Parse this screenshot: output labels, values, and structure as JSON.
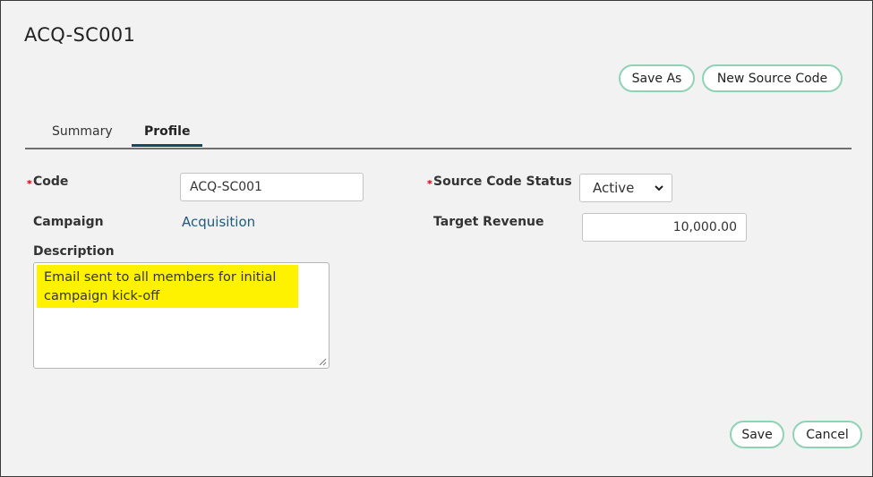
{
  "page": {
    "title": "ACQ-SC001"
  },
  "toolbar": {
    "save_as_label": "Save As",
    "new_source_code_label": "New Source Code"
  },
  "tabs": [
    {
      "label": "Summary",
      "active": false
    },
    {
      "label": "Profile",
      "active": true
    }
  ],
  "form": {
    "code": {
      "label": "Code",
      "required": true,
      "value": "ACQ-SC001"
    },
    "campaign": {
      "label": "Campaign",
      "value": "Acquisition"
    },
    "description": {
      "label": "Description",
      "value": "Email sent to all members for initial campaign kick-off"
    },
    "source_code_status": {
      "label": "Source Code Status",
      "required": true,
      "selected": "Active"
    },
    "target_revenue": {
      "label": "Target Revenue",
      "value": "10,000.00"
    }
  },
  "footer": {
    "save_label": "Save",
    "cancel_label": "Cancel"
  },
  "colors": {
    "button_border": "#8fd3b4",
    "tab_active_underline": "#0f4c5c",
    "link": "#1e5b7e",
    "required": "#cc0000",
    "highlight": "#fff200"
  },
  "icons": {
    "select_caret": "chevron-down-icon",
    "textarea_grip": "resize-grip-icon"
  }
}
